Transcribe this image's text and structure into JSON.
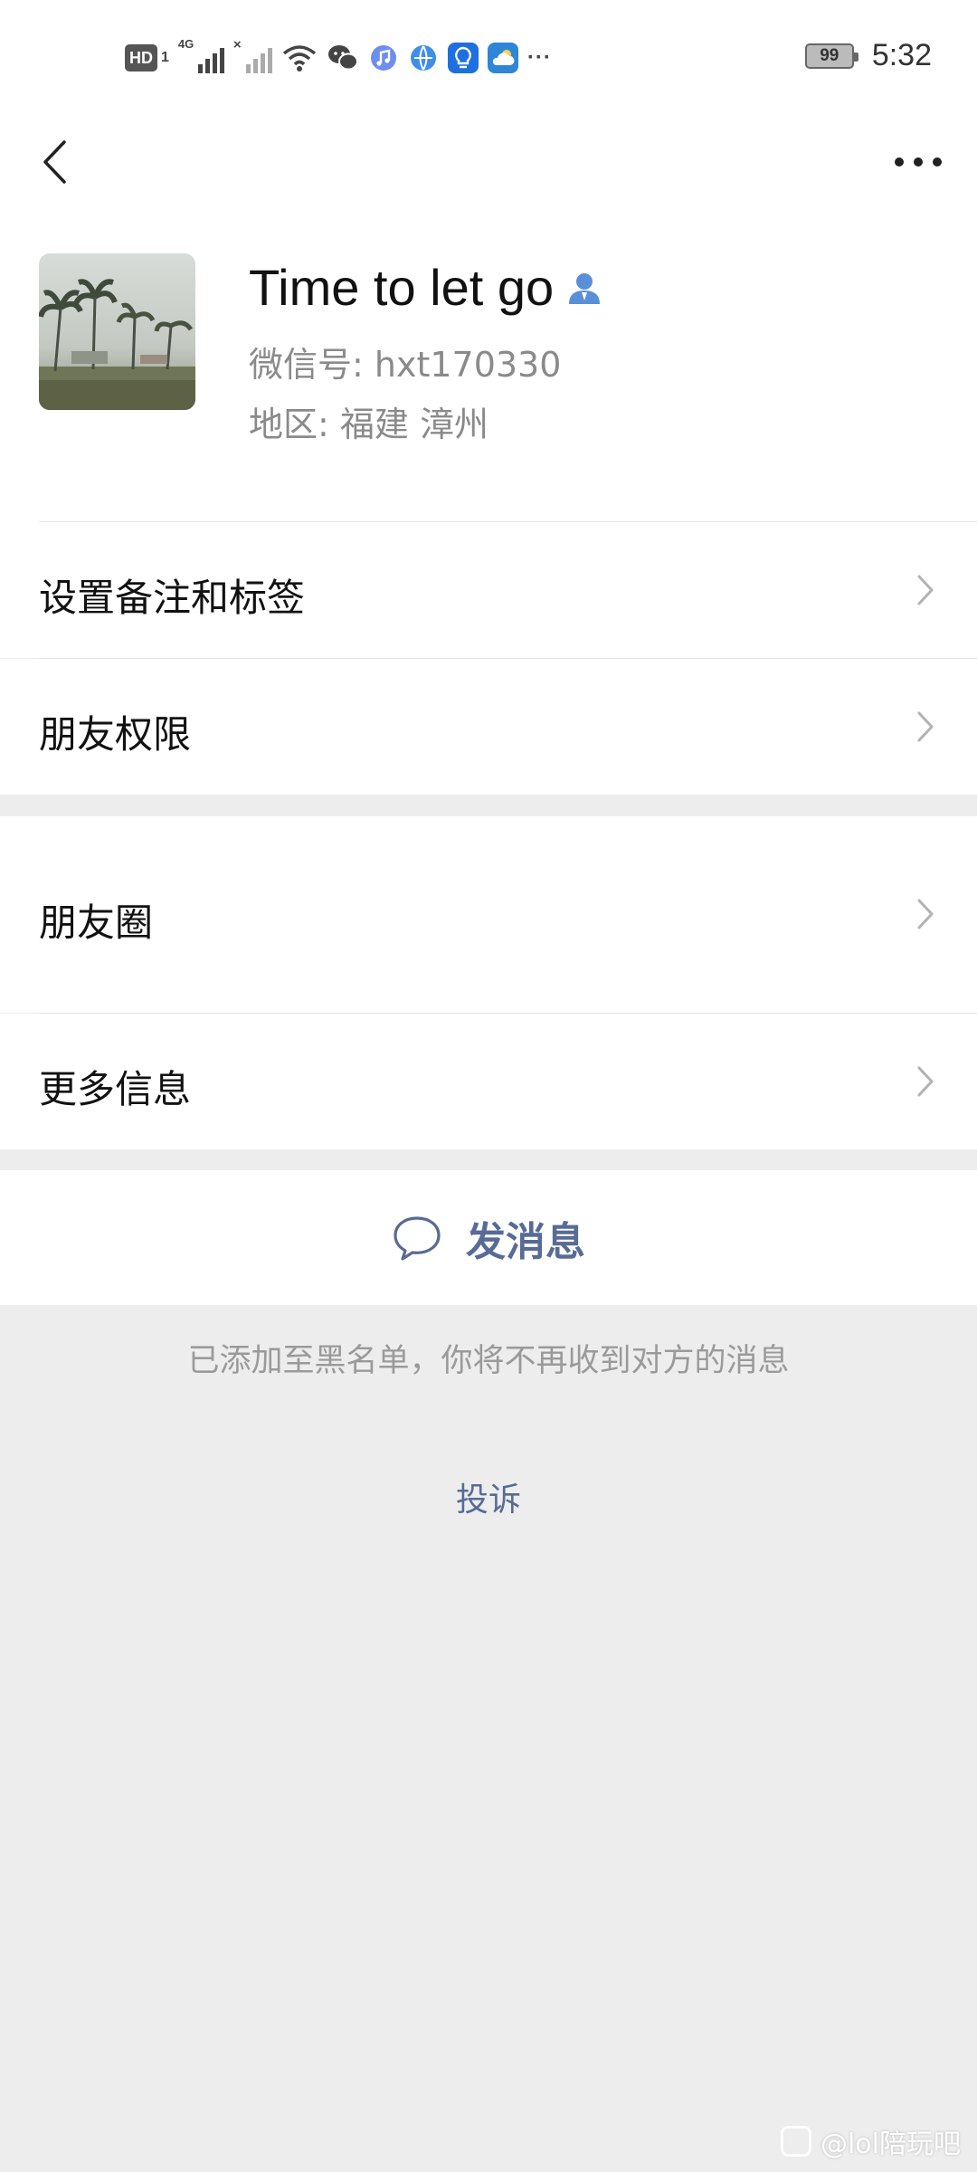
{
  "status_bar": {
    "hd_label": "HD",
    "sim_label": "1",
    "network_label": "4G",
    "battery_level": "99",
    "time": "5:32",
    "more_indicator": "···",
    "icons": [
      "signal-icon",
      "signal-off-icon",
      "wifi-icon",
      "wechat-icon",
      "music-app-icon",
      "browser-app-icon",
      "bulb-app-icon",
      "weather-app-icon"
    ]
  },
  "navbar": {
    "back_icon": "chevron-left-icon",
    "more_icon": "more-dots-icon"
  },
  "profile": {
    "name": "Time to let go",
    "wechat_id": "微信号: hxt170330",
    "region": "地区: 福建  漳州",
    "badge_icon": "person-icon"
  },
  "menu": {
    "remark_tags": "设置备注和标签",
    "friend_permissions": "朋友权限",
    "moments": "朋友圈",
    "more_info": "更多信息"
  },
  "actions": {
    "send_message": "发消息",
    "send_icon": "chat-bubble-icon"
  },
  "blacklist_notice": "已添加至黑名单，你将不再收到对方的消息",
  "complain_link": "投诉",
  "watermark": "@lol陪玩吧",
  "colors": {
    "link": "#576b95",
    "secondary_text": "#8a8a8a",
    "background": "#ededed",
    "card": "#ffffff"
  }
}
